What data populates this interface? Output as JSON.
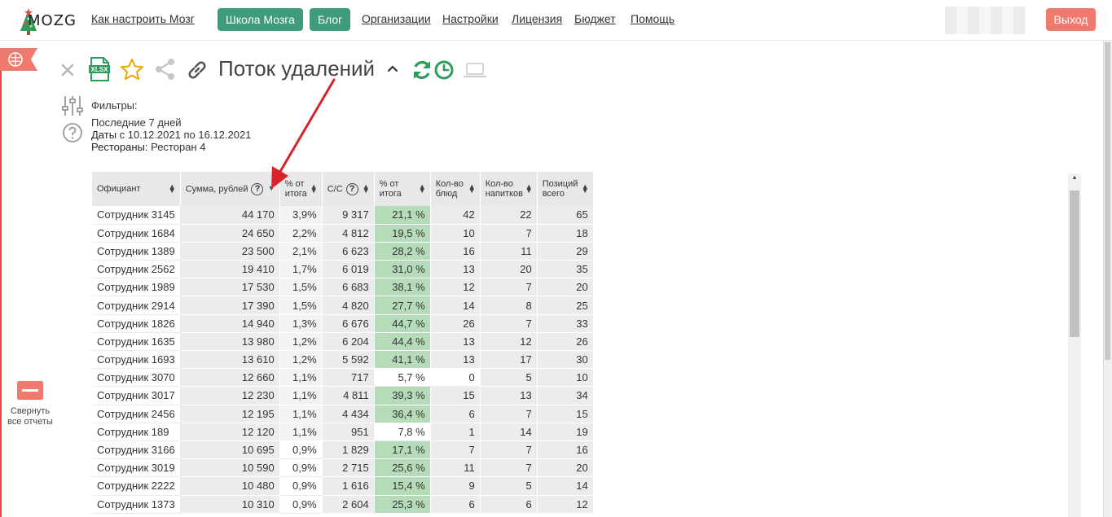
{
  "nav": {
    "logo_text": "MOZG",
    "links": [
      "Как настроить Мозг",
      "Организации",
      "Настройки",
      "Лицензия",
      "Бюджет",
      "Помощь"
    ],
    "buttons": [
      "Школа Мозга",
      "Блог"
    ],
    "logout": "Выход"
  },
  "sidebar": {
    "collapse_label": "Свернуть все отчеты"
  },
  "report": {
    "title": "Поток удалений",
    "xlsx_label": "XLSX",
    "filters_label": "Фильтры:",
    "filter_period": "Последние 7 дней",
    "filter_dates_label": "Даты",
    "filter_dates_value": "с 10.12.2021 по 16.12.2021",
    "filter_restaurants_label": "Рестораны:",
    "filter_restaurants_value": "Ресторан 4"
  },
  "table": {
    "headers": [
      "Официант",
      "Сумма, рублей",
      "% от итога",
      "С/С",
      "% от итога",
      "Кол-во блюд",
      "Кол-во напитков",
      "Позиций всего"
    ],
    "rows": [
      {
        "name": "Сотрудник 3145",
        "sum": "44 170",
        "pct": "3,9%",
        "cost": "9 317",
        "cost_pct": "21,1 %",
        "dishes": "42",
        "drinks": "22",
        "total": "65"
      },
      {
        "name": "Сотрудник 1684",
        "sum": "24 650",
        "pct": "2,2%",
        "cost": "4 812",
        "cost_pct": "19,5 %",
        "dishes": "10",
        "drinks": "7",
        "total": "18"
      },
      {
        "name": "Сотрудник 1389",
        "sum": "23 500",
        "pct": "2,1%",
        "cost": "6 623",
        "cost_pct": "28,2 %",
        "dishes": "16",
        "drinks": "11",
        "total": "29"
      },
      {
        "name": "Сотрудник 2562",
        "sum": "19 410",
        "pct": "1,7%",
        "cost": "6 019",
        "cost_pct": "31,0 %",
        "dishes": "13",
        "drinks": "20",
        "total": "35"
      },
      {
        "name": "Сотрудник 1989",
        "sum": "17 530",
        "pct": "1,5%",
        "cost": "6 683",
        "cost_pct": "38,1 %",
        "dishes": "12",
        "drinks": "7",
        "total": "20"
      },
      {
        "name": "Сотрудник 2914",
        "sum": "17 390",
        "pct": "1,5%",
        "cost": "4 820",
        "cost_pct": "27,7 %",
        "dishes": "14",
        "drinks": "8",
        "total": "25"
      },
      {
        "name": "Сотрудник 1826",
        "sum": "14 940",
        "pct": "1,3%",
        "cost": "6 676",
        "cost_pct": "44,7 %",
        "dishes": "26",
        "drinks": "7",
        "total": "33"
      },
      {
        "name": "Сотрудник 1635",
        "sum": "13 980",
        "pct": "1,2%",
        "cost": "6 204",
        "cost_pct": "44,4 %",
        "dishes": "13",
        "drinks": "12",
        "total": "26"
      },
      {
        "name": "Сотрудник 1693",
        "sum": "13 610",
        "pct": "1,2%",
        "cost": "5 592",
        "cost_pct": "41,1 %",
        "dishes": "13",
        "drinks": "17",
        "total": "30"
      },
      {
        "name": "Сотрудник 3070",
        "sum": "12 660",
        "pct": "1,1%",
        "cost": "717",
        "cost_pct": "5,7 %",
        "dishes": "0",
        "drinks": "5",
        "total": "10"
      },
      {
        "name": "Сотрудник 3017",
        "sum": "12 230",
        "pct": "1,1%",
        "cost": "4 811",
        "cost_pct": "39,3 %",
        "dishes": "15",
        "drinks": "13",
        "total": "34"
      },
      {
        "name": "Сотрудник 2456",
        "sum": "12 195",
        "pct": "1,1%",
        "cost": "4 434",
        "cost_pct": "36,4 %",
        "dishes": "6",
        "drinks": "7",
        "total": "15"
      },
      {
        "name": "Сотрудник 189",
        "sum": "12 120",
        "pct": "1,1%",
        "cost": "951",
        "cost_pct": "7,8 %",
        "dishes": "1",
        "drinks": "14",
        "total": "19"
      },
      {
        "name": "Сотрудник 3166",
        "sum": "10 695",
        "pct": "0,9%",
        "cost": "1 829",
        "cost_pct": "17,1 %",
        "dishes": "7",
        "drinks": "7",
        "total": "16"
      },
      {
        "name": "Сотрудник 3019",
        "sum": "10 590",
        "pct": "0,9%",
        "cost": "2 715",
        "cost_pct": "25,6 %",
        "dishes": "11",
        "drinks": "7",
        "total": "20"
      },
      {
        "name": "Сотрудник 2222",
        "sum": "10 480",
        "pct": "0,9%",
        "cost": "1 616",
        "cost_pct": "15,4 %",
        "dishes": "9",
        "drinks": "5",
        "total": "14"
      },
      {
        "name": "Сотрудник 1373",
        "sum": "10 310",
        "pct": "0,9%",
        "cost": "2 604",
        "cost_pct": "25,3 %",
        "dishes": "6",
        "drinks": "6",
        "total": "12"
      }
    ]
  },
  "colors": {
    "accent_green": "#3f9b7a",
    "logout_red": "#f07a6e",
    "highlight_green": "#b6dbb9",
    "arrow_red": "#d9232b"
  }
}
